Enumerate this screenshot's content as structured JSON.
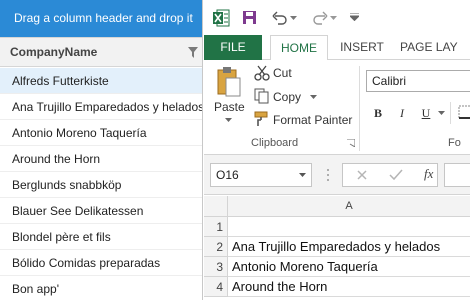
{
  "grid": {
    "group_panel_text": "Drag a column header and drop it",
    "column_header": "CompanyName",
    "rows": [
      "Alfreds Futterkiste",
      "Ana Trujillo Emparedados y helados",
      "Antonio Moreno Taquería",
      "Around the Horn",
      "Berglunds snabbköp",
      "Blauer See Delikatessen",
      "Blondel père et fils",
      "Bólido Comidas preparadas",
      "Bon app'"
    ],
    "selected_row": 0
  },
  "excel": {
    "tabs": {
      "file": "FILE",
      "home": "HOME",
      "insert": "INSERT",
      "page_layout": "PAGE LAY"
    },
    "clipboard": {
      "paste": "Paste",
      "cut": "Cut",
      "copy": "Copy",
      "format_painter": "Format Painter",
      "group_label": "Clipboard"
    },
    "font": {
      "name": "Calibri",
      "bold": "B",
      "italic": "I",
      "underline": "U",
      "group_label_partial": "Fo"
    },
    "name_box": "O16",
    "fx": "fx",
    "column_a": "A",
    "rows": [
      {
        "num": "1",
        "value": ""
      },
      {
        "num": "2",
        "value": "Ana Trujillo Emparedados y helados"
      },
      {
        "num": "3",
        "value": "Antonio Moreno Taquería"
      },
      {
        "num": "4",
        "value": "Around the Horn"
      }
    ],
    "accent_color": "#217346",
    "grid_accent_color": "#2b8ad6"
  }
}
